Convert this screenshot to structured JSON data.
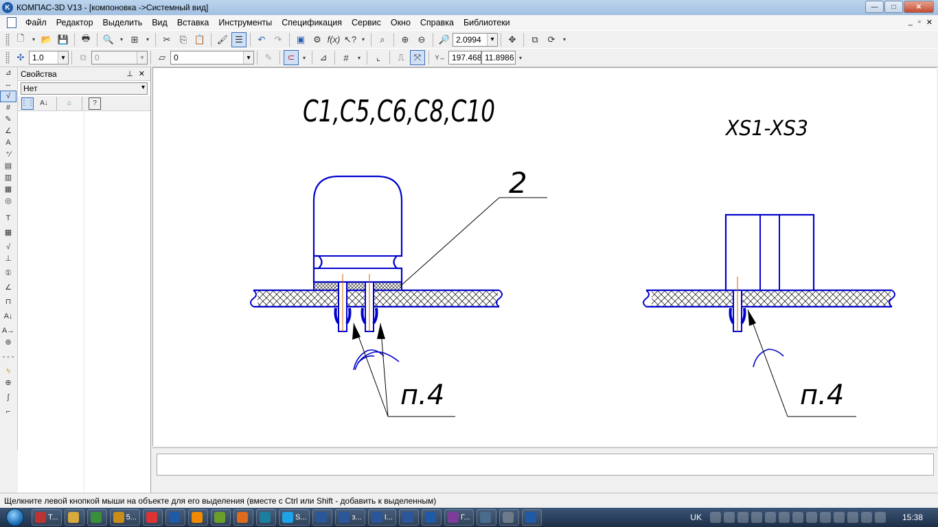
{
  "window": {
    "title": "КОМПАС-3D V13 - [компоновка ->Системный вид]",
    "app_icon": "kompas-logo-icon",
    "controls": [
      "minimize-icon",
      "maximize-icon",
      "close-icon"
    ]
  },
  "menu": {
    "items": [
      {
        "label": "Файл"
      },
      {
        "label": "Редактор"
      },
      {
        "label": "Выделить"
      },
      {
        "label": "Вид"
      },
      {
        "label": "Вставка"
      },
      {
        "label": "Инструменты"
      },
      {
        "label": "Спецификация"
      },
      {
        "label": "Сервис"
      },
      {
        "label": "Окно"
      },
      {
        "label": "Справка"
      },
      {
        "label": "Библиотеки"
      }
    ],
    "mdi_controls": [
      "minimize-icon",
      "restore-icon",
      "close-icon"
    ]
  },
  "toolbar1": {
    "zoom_value": "2.0994",
    "icons": [
      "new-doc-icon",
      "open-folder-icon",
      "save-icon",
      "print-icon",
      "preview-icon",
      "layout-icon",
      "cut-icon",
      "copy-icon",
      "paste-icon",
      "brush-icon",
      "properties-icon",
      "undo-icon",
      "redo-icon",
      "manager-icon",
      "library-icon",
      "fx-icon",
      "help-cursor-icon",
      "zoom-icon",
      "zoom-in-icon",
      "zoom-out-icon",
      "zoom-scale-icon",
      "pan-icon",
      "views-icon",
      "refresh-icon"
    ]
  },
  "toolbar2": {
    "scale_value": "1.0",
    "layer_value": "0",
    "style_value": "0",
    "coord_x": "197.468",
    "coord_y": "11.8986",
    "icons": [
      "snap-icon",
      "layer-icon",
      "style-icon",
      "magnet-icon",
      "grid-icon",
      "ortho-icon",
      "local-cs-icon",
      "cursor-coord-icon"
    ]
  },
  "left_toolbar": {
    "icons": [
      "geometry-icon",
      "dimensions-icon",
      "symbols-icon",
      "edit-icon",
      "parametric-icon",
      "measure-icon",
      "select-icon",
      "associative-icon",
      "spec-icon",
      "reports-icon",
      "insert-icon",
      "fragment-icon",
      "text-icon",
      "table-icon",
      "roughness-icon",
      "base-icon",
      "leader-icon",
      "position-icon",
      "tolerance-icon",
      "cut-line-icon",
      "arrow-icon",
      "view-arrow-icon",
      "axis-icon",
      "mark-icon",
      "center-icon",
      "wave-icon",
      "bracket-icon"
    ]
  },
  "properties": {
    "title": "Свойства",
    "selected": "Нет",
    "tools": [
      "sort-icon",
      "sort-az-icon",
      "filter-icon",
      "help-icon"
    ],
    "header_icons": [
      "pin-icon",
      "close-icon"
    ]
  },
  "drawing": {
    "label_left": "C1,C5,C6,C8,C10",
    "label_right": "XS1-XS3",
    "callout_2": "2",
    "callout_p4_left": "п.4",
    "callout_p4_right": "п.4",
    "line_color": "#0000cc",
    "text_color": "#000000",
    "center_line_color": "#cc6600"
  },
  "status": {
    "text": "Щелкните левой кнопкой мыши на объекте для его выделения (вместе с Ctrl или Shift - добавить к выделенным)"
  },
  "taskbar": {
    "start_icon": "windows-start-icon",
    "tasks": [
      {
        "label": "T...",
        "icon": "pdf-icon",
        "color": "#b33"
      },
      {
        "label": "",
        "icon": "explorer-icon",
        "color": "#d9a93b"
      },
      {
        "label": "",
        "icon": "chrome-icon",
        "color": "#3a8f3a"
      },
      {
        "label": "5...",
        "icon": "kompas-task-icon",
        "color": "#c98d17"
      },
      {
        "label": "",
        "icon": "yandex-icon",
        "color": "#d33"
      },
      {
        "label": "",
        "icon": "browser-icon",
        "color": "#1f5aa6"
      },
      {
        "label": "",
        "icon": "odnoklassniki-icon",
        "color": "#f08a00"
      },
      {
        "label": "",
        "icon": "app-green-icon",
        "color": "#6a9f2a"
      },
      {
        "label": "",
        "icon": "firefox-icon",
        "color": "#e06a1b"
      },
      {
        "label": "",
        "icon": "app-diamond-icon",
        "color": "#1d7fa0"
      },
      {
        "label": "S...",
        "icon": "skype-icon",
        "color": "#1ca3e8"
      },
      {
        "label": "",
        "icon": "word-icon",
        "color": "#2b579a"
      },
      {
        "label": "з...",
        "icon": "word-icon",
        "color": "#2b579a"
      },
      {
        "label": "I...",
        "icon": "word-icon",
        "color": "#2b579a"
      },
      {
        "label": "",
        "icon": "word-icon",
        "color": "#2b579a"
      },
      {
        "label": "",
        "icon": "kompas-icon",
        "color": "#1f5aa6"
      },
      {
        "label": "Г...",
        "icon": "purple-app-icon",
        "color": "#7d3c98"
      },
      {
        "label": "",
        "icon": "remote-icon",
        "color": "#4a6c8c"
      },
      {
        "label": "",
        "icon": "speed-icon",
        "color": "#6c7a89"
      },
      {
        "label": "",
        "icon": "kompas-icon",
        "color": "#1f5aa6"
      }
    ],
    "lang": "UK",
    "clock": "15:38",
    "tray_icons": [
      "no-entry-icon",
      "network-icon",
      "download-icon",
      "norton-icon",
      "skull-icon",
      "dropbox-icon",
      "tools-icon",
      "apple-icon",
      "chrome-tray-icon",
      "volume-icon",
      "battery-icon",
      "signal-icon",
      "flag-icon"
    ]
  }
}
